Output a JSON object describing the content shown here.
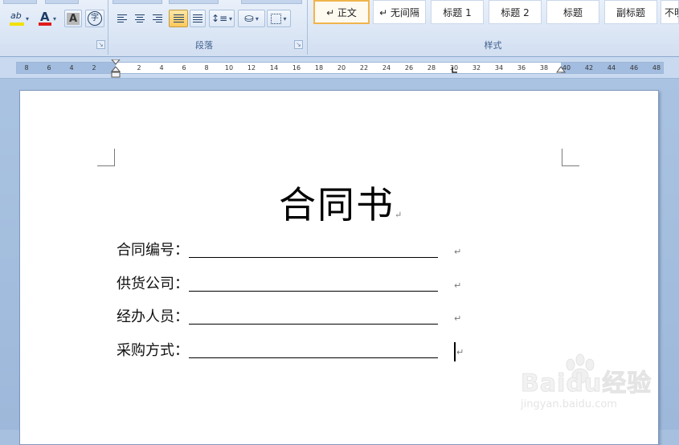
{
  "ribbon": {
    "groups": {
      "paragraph_label": "段落",
      "styles_label": "样式"
    },
    "font_tools": {
      "highlight_glyph": "ab",
      "font_color_glyph": "A",
      "char_shading_glyph": "A",
      "enclose_char_glyph": "字",
      "highlight_color": "#f2e000",
      "font_color": "#e01b1b"
    },
    "paragraph_tools": {
      "align_left": "align-left-icon",
      "align_center": "align-center-icon",
      "align_right": "align-right-icon",
      "justify": "justify-icon",
      "distributed": "distributed-icon",
      "line_spacing": "line-spacing-icon",
      "shading": "paint-bucket-icon",
      "borders": "borders-icon"
    },
    "styles": [
      {
        "label": "↵ 正文",
        "selected": true
      },
      {
        "label": "↵ 无间隔",
        "selected": false
      },
      {
        "label": "标题 1",
        "selected": false
      },
      {
        "label": "标题 2",
        "selected": false
      },
      {
        "label": "标题",
        "selected": false
      },
      {
        "label": "副标题",
        "selected": false
      },
      {
        "label": "不明",
        "selected": false
      }
    ]
  },
  "ruler": {
    "left_numbers": [
      "8",
      "6",
      "4",
      "2"
    ],
    "right_numbers": [
      "2",
      "4",
      "6",
      "8",
      "10",
      "12",
      "14",
      "16",
      "18",
      "20",
      "22",
      "24",
      "26",
      "28",
      "30",
      "32",
      "34",
      "36",
      "38",
      "40",
      "42",
      "44",
      "46",
      "48"
    ]
  },
  "document": {
    "title": "合同书",
    "paragraph_mark": "↵",
    "fields": [
      {
        "label": "合同编号："
      },
      {
        "label": "供货公司："
      },
      {
        "label": "经办人员："
      },
      {
        "label": "采购方式："
      }
    ]
  },
  "watermark": {
    "brand": "Baidu经验",
    "url": "jingyan.baidu.com"
  }
}
